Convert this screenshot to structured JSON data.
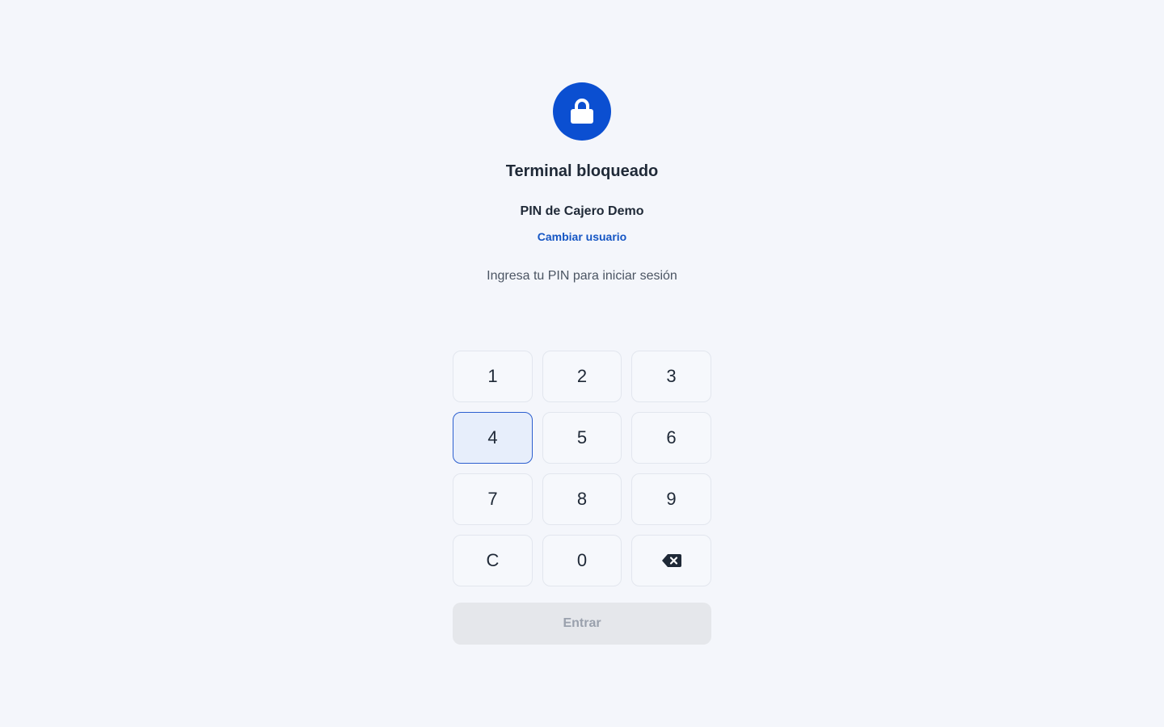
{
  "lock": {
    "icon": "lock-icon",
    "color": "#0b4fd1"
  },
  "header": {
    "title": "Terminal bloqueado",
    "user_name": "PIN de Cajero Demo",
    "switch_user_label": "Cambiar usuario",
    "subtitle": "Ingresa tu PIN para iniciar sesión"
  },
  "keypad": {
    "keys": [
      "1",
      "2",
      "3",
      "4",
      "5",
      "6",
      "7",
      "8",
      "9",
      "C",
      "0"
    ],
    "backspace_icon": "backspace-icon",
    "active_key": "4"
  },
  "actions": {
    "enter_label": "Entrar",
    "enter_enabled": false
  },
  "colors": {
    "accent": "#0b4fd1",
    "link": "#1556c4",
    "background": "#f4f6fb"
  }
}
